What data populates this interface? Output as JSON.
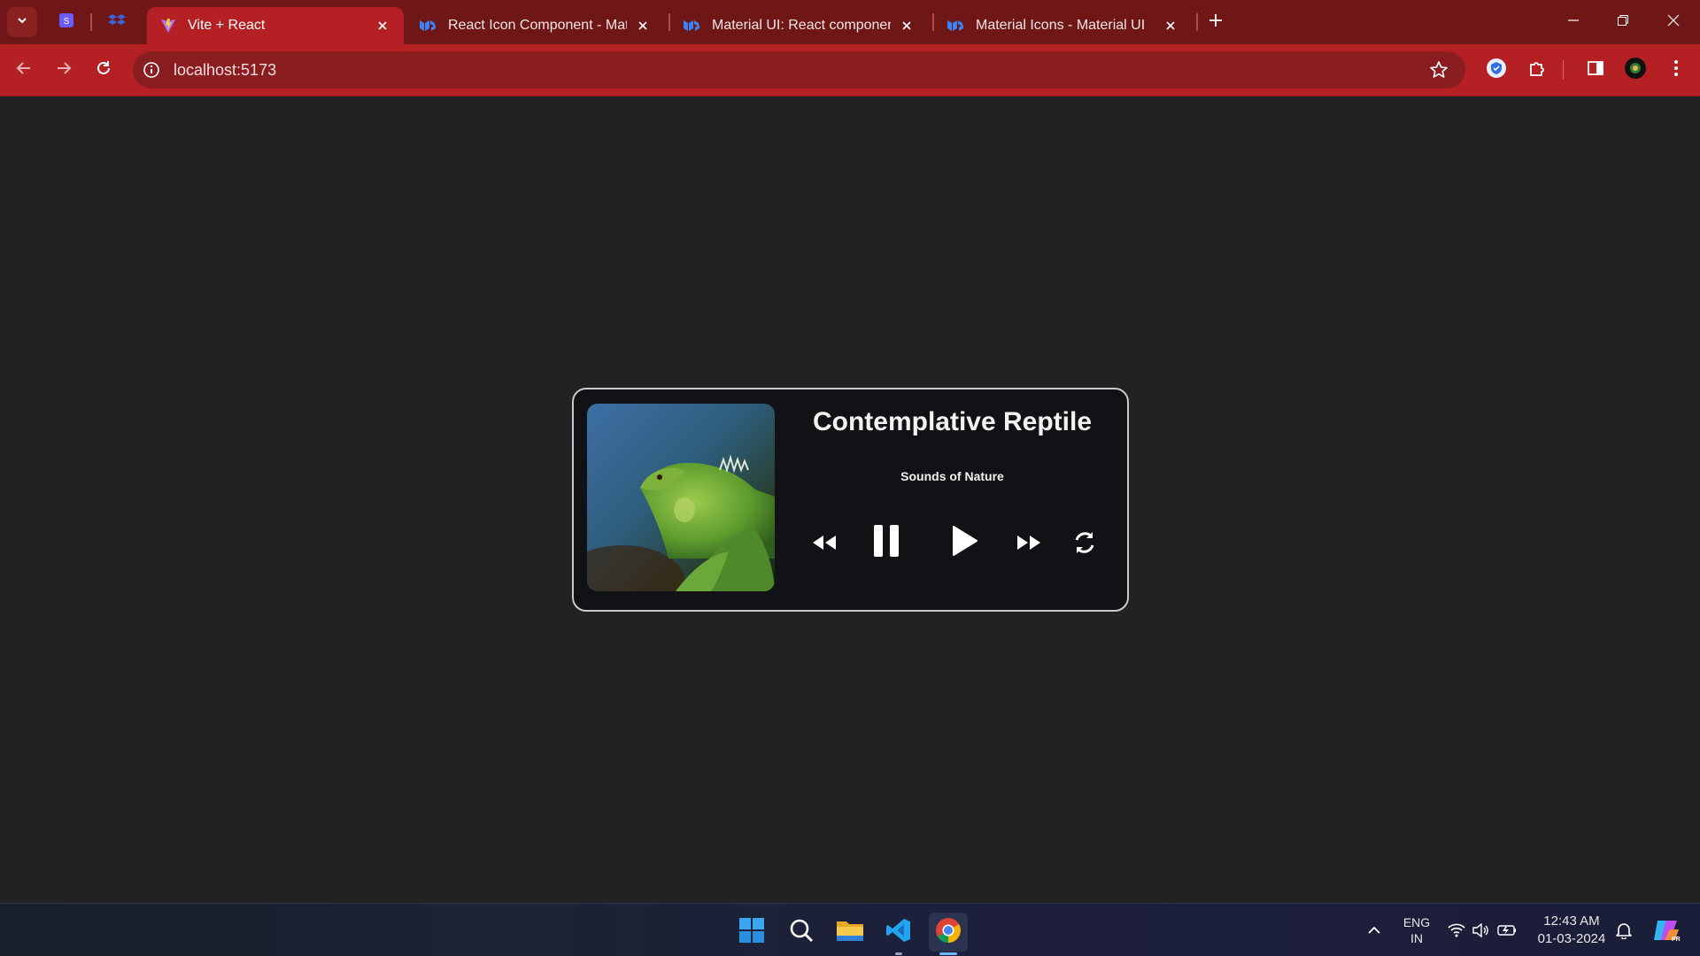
{
  "browser": {
    "tabs": [
      {
        "title": "Vite + React",
        "active": true
      },
      {
        "title": "React Icon Component - Material",
        "active": false
      },
      {
        "title": "Material UI: React components",
        "active": false
      },
      {
        "title": "Material Icons - Material UI",
        "active": false
      }
    ],
    "url": "localhost:5173",
    "colors": {
      "frame": "#6f1716",
      "toolbar": "#b52025",
      "omnibox": "#8a1d1f"
    }
  },
  "player": {
    "title": "Contemplative Reptile",
    "artist": "Sounds of Nature",
    "cover_icon": "iguana-cover-image",
    "controls": [
      "rewind-icon",
      "pause-icon",
      "play-icon",
      "fast-forward-icon",
      "repeat-icon"
    ]
  },
  "taskbar": {
    "language_line1": "ENG",
    "language_line2": "IN",
    "time": "12:43 AM",
    "date": "01-03-2024",
    "pinned": [
      "windows-start-icon",
      "search-icon",
      "file-explorer-icon",
      "vscode-icon",
      "chrome-icon"
    ]
  }
}
